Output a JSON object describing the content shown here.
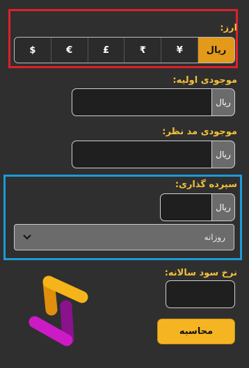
{
  "currency": {
    "label": "ارز:",
    "options": [
      "$",
      "€",
      "£",
      "₹",
      "¥",
      "ریال"
    ],
    "selected": "ریال"
  },
  "initial_balance": {
    "label": "موجودی اولیه:",
    "value": "",
    "unit": "ریال"
  },
  "target_balance": {
    "label": "موجودی مد نظر:",
    "value": "",
    "unit": "ریال"
  },
  "deposit": {
    "label": "سپرده گذاری:",
    "value": "",
    "unit": "ریال",
    "frequency_selected": "روزانه"
  },
  "annual_rate": {
    "label": "نرخ سود سالانه:",
    "value": ""
  },
  "actions": {
    "calculate_label": "محاسبه"
  },
  "colors": {
    "background": "#2f2f2f",
    "accent": "#f5b523",
    "currency_highlight": "#e0202b",
    "deposit_highlight": "#1d9ad8",
    "logo_yellow": "#f5b41a",
    "logo_orange": "#e08f0c",
    "logo_magenta": "#cc1bc4",
    "logo_purple": "#8a128c"
  }
}
